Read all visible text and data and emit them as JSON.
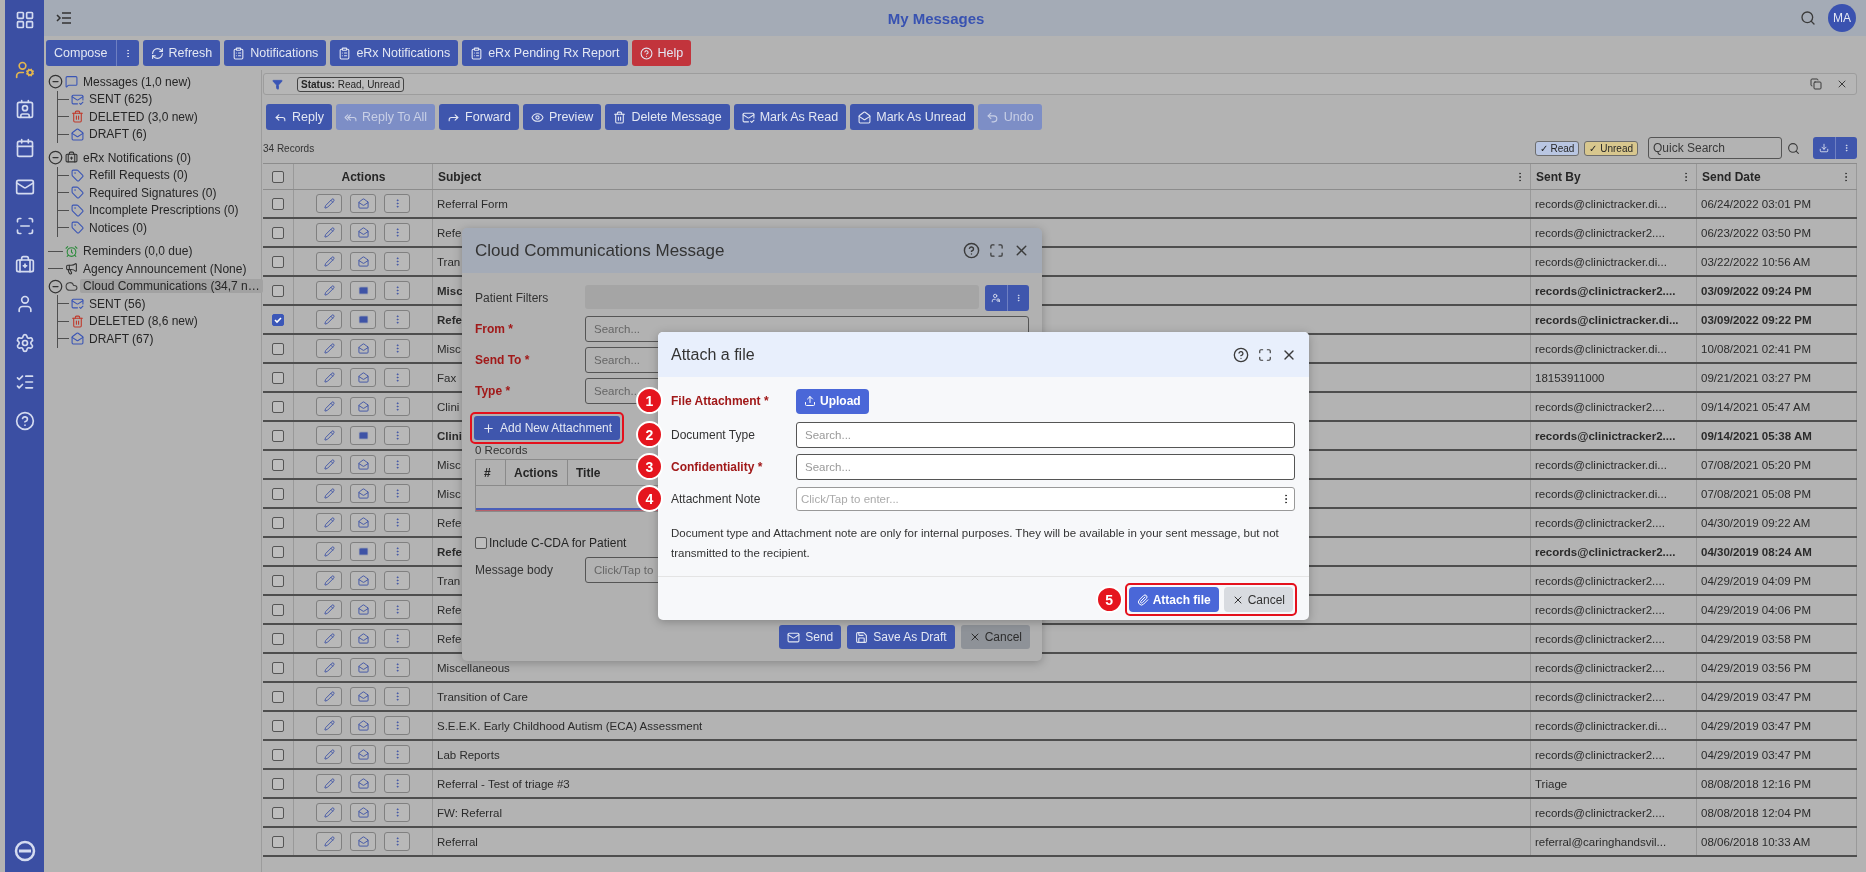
{
  "header": {
    "title": "My Messages",
    "avatar": "MA"
  },
  "toolbar": [
    {
      "label": "Compose",
      "kind": "compose"
    },
    {
      "label": "Refresh",
      "kind": "refresh"
    },
    {
      "label": "Notifications",
      "kind": "report"
    },
    {
      "label": "eRx Notifications",
      "kind": "report"
    },
    {
      "label": "eRx Pending Rx Report",
      "kind": "report"
    },
    {
      "label": "Help",
      "kind": "help"
    }
  ],
  "tree": [
    {
      "label": "Messages (1,0 new)",
      "kind": "messages",
      "selected": false,
      "expanded": true,
      "children": [
        {
          "label": "SENT (625)",
          "kind": "sent",
          "selected": false
        },
        {
          "label": "DELETED (3,0 new)",
          "kind": "deleted",
          "selected": false
        },
        {
          "label": "DRAFT (6)",
          "kind": "draft",
          "selected": false
        }
      ]
    },
    {
      "label": "eRx Notifications (0)",
      "kind": "erx",
      "selected": false,
      "expanded": true,
      "children": [
        {
          "label": "Refill Requests (0)",
          "kind": "tag",
          "selected": false
        },
        {
          "label": "Required Signatures (0)",
          "kind": "tag",
          "selected": false
        },
        {
          "label": "Incomplete Prescriptions (0)",
          "kind": "tag",
          "selected": false
        },
        {
          "label": "Notices (0)",
          "kind": "tag",
          "selected": false
        }
      ]
    },
    {
      "label": "Reminders (0,0 due)",
      "kind": "reminder",
      "selected": false
    },
    {
      "label": "Agency Announcement (None)",
      "kind": "announcement",
      "selected": false
    },
    {
      "label": "Cloud Communications (34,7 n…",
      "kind": "cloud",
      "selected": true,
      "expanded": true,
      "children": [
        {
          "label": "SENT (56)",
          "kind": "sent",
          "selected": false
        },
        {
          "label": "DELETED (8,6 new)",
          "kind": "deleted",
          "selected": false
        },
        {
          "label": "DRAFT (67)",
          "kind": "draft",
          "selected": false
        }
      ]
    }
  ],
  "filter": {
    "chip": "**Status:** Read, Unread"
  },
  "actions": [
    {
      "label": "Reply",
      "kind": "reply",
      "disabled": false
    },
    {
      "label": "Reply To All",
      "kind": "reply-all",
      "disabled": true
    },
    {
      "label": "Forward",
      "kind": "forward",
      "disabled": false
    },
    {
      "label": "Preview",
      "kind": "preview",
      "disabled": false
    },
    {
      "label": "Delete Message",
      "kind": "delete",
      "disabled": false
    },
    {
      "label": "Mark As Read",
      "kind": "mark-read",
      "disabled": false
    },
    {
      "label": "Mark As Unread",
      "kind": "mark-unread",
      "disabled": false
    },
    {
      "label": "Undo",
      "kind": "undo",
      "disabled": true
    }
  ],
  "records": "34 Records",
  "legend": [
    {
      "label": "✓ Read",
      "color": "#b9c6e2"
    },
    {
      "label": "✓ Unread",
      "color": "#d8c78e"
    }
  ],
  "quick_search": {
    "placeholder": "Quick Search"
  },
  "table": {
    "all_selected": false,
    "columns": [
      "Actions",
      "Subject",
      "Sent By",
      "Send Date"
    ],
    "rows": [
      {
        "subject": "Referral Form",
        "sent_by": "records@clinictracker.di...",
        "send_date": "06/24/2022 03:01 PM",
        "unread": false,
        "selected": false
      },
      {
        "subject": "Refe",
        "sent_by": "records@clinictracker2....",
        "send_date": "06/23/2022 03:50 PM",
        "unread": false,
        "selected": false
      },
      {
        "subject": "Tran",
        "sent_by": "records@clinictracker.di...",
        "send_date": "03/22/2022 10:56 AM",
        "unread": false,
        "selected": false
      },
      {
        "subject": "Misc",
        "sent_by": "records@clinictracker2....",
        "send_date": "03/09/2022 09:24 PM",
        "unread": true,
        "selected": false
      },
      {
        "subject": "Refe",
        "sent_by": "records@clinictracker.di...",
        "send_date": "03/09/2022 09:22 PM",
        "unread": true,
        "selected": true
      },
      {
        "subject": "Misc",
        "sent_by": "records@clinictracker.di...",
        "send_date": "10/08/2021 02:41 PM",
        "unread": false,
        "selected": false
      },
      {
        "subject": "Fax",
        "sent_by": "18153911000",
        "send_date": "09/21/2021 03:27 PM",
        "unread": false,
        "selected": false
      },
      {
        "subject": "Clini",
        "sent_by": "records@clinictracker2....",
        "send_date": "09/14/2021 05:47 AM",
        "unread": false,
        "selected": false
      },
      {
        "subject": "Clini",
        "sent_by": "records@clinictracker2....",
        "send_date": "09/14/2021 05:38 AM",
        "unread": true,
        "selected": false
      },
      {
        "subject": "Misc",
        "sent_by": "records@clinictracker.di...",
        "send_date": "07/08/2021 05:20 PM",
        "unread": false,
        "selected": false
      },
      {
        "subject": "Misc",
        "sent_by": "records@clinictracker.di...",
        "send_date": "07/08/2021 05:08 PM",
        "unread": false,
        "selected": false
      },
      {
        "subject": "Refe",
        "sent_by": "records@clinictracker2....",
        "send_date": "04/30/2019 09:22 AM",
        "unread": false,
        "selected": false
      },
      {
        "subject": "Refe",
        "sent_by": "records@clinictracker2....",
        "send_date": "04/30/2019 08:24 AM",
        "unread": true,
        "selected": false
      },
      {
        "subject": "Tran",
        "sent_by": "records@clinictracker2....",
        "send_date": "04/29/2019 04:09 PM",
        "unread": false,
        "selected": false
      },
      {
        "subject": "Refe",
        "sent_by": "records@clinictracker2....",
        "send_date": "04/29/2019 04:06 PM",
        "unread": false,
        "selected": false
      },
      {
        "subject": "Refe",
        "sent_by": "records@clinictracker2....",
        "send_date": "04/29/2019 03:58 PM",
        "unread": false,
        "selected": false
      },
      {
        "subject": "Miscellaneous",
        "sent_by": "records@clinictracker2....",
        "send_date": "04/29/2019 03:56 PM",
        "unread": false,
        "selected": false
      },
      {
        "subject": "Transition of Care",
        "sent_by": "records@clinictracker2....",
        "send_date": "04/29/2019 03:47 PM",
        "unread": false,
        "selected": false
      },
      {
        "subject": "S.E.E.K. Early Childhood Autism (ECA) Assessment",
        "sent_by": "records@clinictracker.di...",
        "send_date": "04/29/2019 03:47 PM",
        "unread": false,
        "selected": false
      },
      {
        "subject": "Lab Reports",
        "sent_by": "records@clinictracker2....",
        "send_date": "04/29/2019 03:47 PM",
        "unread": false,
        "selected": false
      },
      {
        "subject": "Referral - Test of triage #3",
        "sent_by": "Triage",
        "send_date": "08/08/2018 12:16 PM",
        "unread": false,
        "selected": false
      },
      {
        "subject": "FW: Referral",
        "sent_by": "records@clinictracker2....",
        "send_date": "08/08/2018 12:04 PM",
        "unread": false,
        "selected": false
      },
      {
        "subject": "Referral",
        "sent_by": "referral@caringhandsvil...",
        "send_date": "08/06/2018 10:33 AM",
        "unread": false,
        "selected": false
      }
    ]
  },
  "message_dialog": {
    "title": "Cloud Communications Message",
    "fields": [
      {
        "label": "Patient Filters",
        "kind": "filter",
        "required": false
      },
      {
        "label": "From *",
        "kind": "select",
        "required": true,
        "placeholder": "Search..."
      },
      {
        "label": "Send To *",
        "kind": "select",
        "required": true,
        "placeholder": "Search..."
      },
      {
        "label": "Type *",
        "kind": "select",
        "required": true,
        "placeholder": "Search..."
      }
    ],
    "add_attachment": {
      "label": "Add New Attachment",
      "highlighted": true
    },
    "attachments": {
      "count": "0 Records",
      "columns": [
        "#",
        "Actions",
        "Title"
      ]
    },
    "include_ccda": {
      "label": "Include C-CDA for Patient",
      "checked": false
    },
    "message_body": {
      "label": "Message body",
      "placeholder": "Click/Tap to"
    },
    "buttons": [
      {
        "label": "Send",
        "kind": "send"
      },
      {
        "label": "Save As Draft",
        "kind": "save"
      },
      {
        "label": "Cancel",
        "kind": "cancel"
      }
    ]
  },
  "attach_dialog": {
    "title": "Attach a file",
    "fields": [
      {
        "marker": "1",
        "label": "File Attachment *",
        "required": true,
        "kind": "upload",
        "button": "Upload"
      },
      {
        "marker": "2",
        "label": "Document Type",
        "required": false,
        "kind": "select",
        "placeholder": "Search..."
      },
      {
        "marker": "3",
        "label": "Confidentiality *",
        "required": true,
        "kind": "select",
        "placeholder": "Search..."
      },
      {
        "marker": "4",
        "label": "Attachment Note",
        "required": false,
        "kind": "note",
        "placeholder": "Click/Tap to enter..."
      }
    ],
    "note": "Document type and Attachment note are only for internal purposes. They will be available in your sent message, but not transmitted to the recipient.",
    "footer": {
      "marker": "5",
      "highlighted": true,
      "buttons": [
        {
          "label": "Attach file",
          "kind": "primary"
        },
        {
          "label": "Cancel",
          "kind": "secondary"
        }
      ]
    }
  }
}
